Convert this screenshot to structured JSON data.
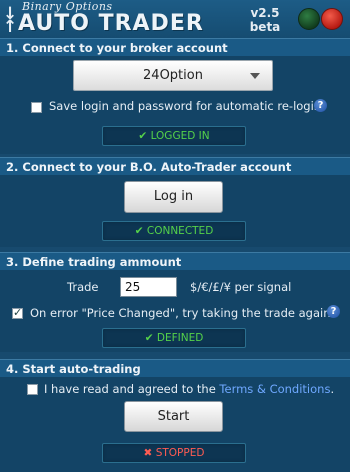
{
  "header": {
    "subtitle": "Binary Options",
    "title": "AUTO TRADER",
    "version": "v2.5",
    "version_tag": "beta"
  },
  "section1": {
    "title": "1. Connect to your broker account",
    "broker_selected": "24Option",
    "save_login_label": "Save login and password for automatic re-login.",
    "save_login_checked": false,
    "status": "LOGGED IN"
  },
  "section2": {
    "title": "2. Connect to your B.O. Auto-Trader account",
    "login_button": "Log in",
    "status": "CONNECTED"
  },
  "section3": {
    "title": "3. Define trading ammount",
    "trade_label": "Trade",
    "trade_value": "25",
    "currency_label": "$/€/£/¥ per signal",
    "price_changed_label": "On error \"Price Changed\", try taking the trade again.",
    "price_changed_checked": true,
    "status": "DEFINED"
  },
  "section4": {
    "title": "4. Start auto-trading",
    "agree_prefix": "I have read and agreed to the ",
    "terms_link": "Terms & Conditions",
    "agree_suffix": ".",
    "agree_checked": false,
    "start_button": "Start",
    "status": "STOPPED"
  },
  "icons": {
    "ok": "✔",
    "stop": "✖",
    "help": "?"
  },
  "colors": {
    "ok": "#55d24a",
    "stopped": "#ff5c52",
    "link": "#6fa8ff"
  }
}
